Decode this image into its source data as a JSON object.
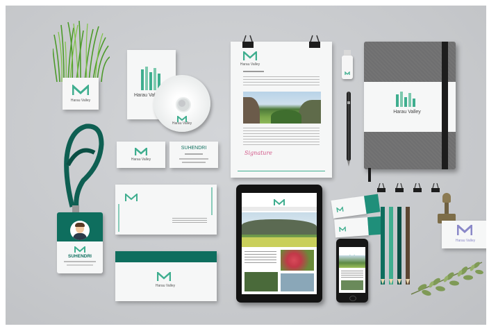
{
  "brand": {
    "name": "Harau Valley",
    "colors": {
      "primary": "#0e6e5e",
      "accent": "#3fae8f",
      "notebook": "#6f6f70"
    }
  },
  "business_card": {
    "name": "SUHENDRI"
  },
  "id_badge": {
    "name": "SUHENDRI"
  },
  "letter": {
    "signature": "Signature"
  },
  "icons": [
    "plant-pot-icon",
    "lanyard-icon",
    "binder-clip-icon",
    "usb-drive-icon",
    "pen-icon",
    "stamp-icon",
    "pencil-icon"
  ]
}
